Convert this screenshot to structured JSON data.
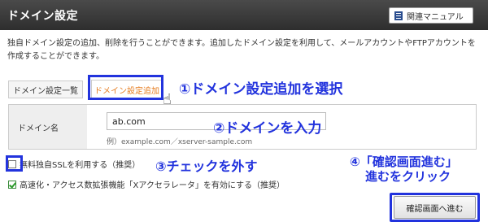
{
  "header": {
    "title": "ドメイン設定",
    "manual_label": "関連マニュアル"
  },
  "description": "独自ドメイン設定の追加、削除を行うことができます。追加したドメイン設定を利用して、メールアカウントやFTPアカウントを作成することができます。",
  "tabs": [
    {
      "label": "ドメイン設定一覧",
      "active": false
    },
    {
      "label": "ドメイン設定追加",
      "active": true
    }
  ],
  "form": {
    "domain_label": "ドメイン名",
    "domain_value": "ab.com",
    "example": "例）example.com／xserver-sample.com"
  },
  "options": {
    "ssl_label": "無料独自SSLを利用する（推奨）",
    "ssl_checked": false,
    "xaccel_label": "高速化・アクセス数拡張機能「Xアクセラレータ」を有効にする（推奨）",
    "xaccel_checked": true
  },
  "confirm_button": "確認画面へ進む",
  "annotations": {
    "step1": "①ドメイン設定追加を選択",
    "step2": "②ドメインを入力",
    "step3": "③チェックを外す",
    "step4_line1": "④「確認画面進む」",
    "step4_line2": "進むをクリック"
  },
  "colors": {
    "highlight": "#2233dd",
    "active_tab": "#e67e22"
  }
}
